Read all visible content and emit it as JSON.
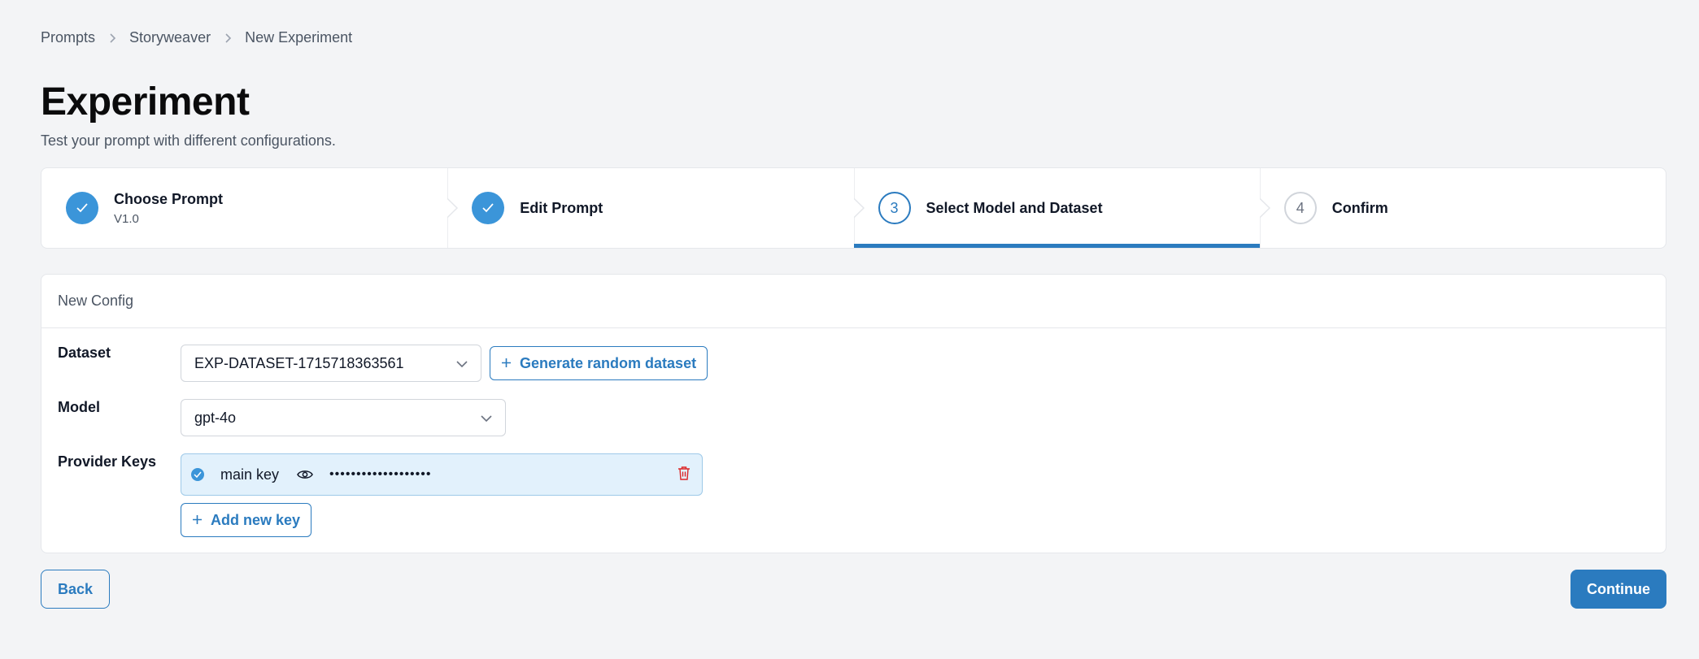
{
  "breadcrumb": {
    "items": [
      "Prompts",
      "Storyweaver",
      "New Experiment"
    ]
  },
  "header": {
    "title": "Experiment",
    "subtitle": "Test your prompt with different configurations."
  },
  "stepper": {
    "steps": [
      {
        "number": "1",
        "label": "Choose Prompt",
        "sublabel": "V1.0",
        "state": "done"
      },
      {
        "number": "2",
        "label": "Edit Prompt",
        "sublabel": "",
        "state": "done"
      },
      {
        "number": "3",
        "label": "Select Model and Dataset",
        "sublabel": "",
        "state": "active"
      },
      {
        "number": "4",
        "label": "Confirm",
        "sublabel": "",
        "state": "todo"
      }
    ]
  },
  "config": {
    "title": "New Config",
    "dataset": {
      "label": "Dataset",
      "value": "EXP-DATASET-1715718363561",
      "generate_label": "Generate random dataset"
    },
    "model": {
      "label": "Model",
      "value": "gpt-4o"
    },
    "provider_keys": {
      "label": "Provider Keys",
      "keys": [
        {
          "name": "main key",
          "masked_value": "•••••••••••••••••••",
          "selected": true
        }
      ],
      "add_label": "Add new key"
    }
  },
  "footer": {
    "back_label": "Back",
    "continue_label": "Continue"
  },
  "colors": {
    "accent": "#2b7bbf",
    "done_step": "#3b95d9",
    "key_bg": "#e2f1fc",
    "delete": "#dc2626"
  }
}
